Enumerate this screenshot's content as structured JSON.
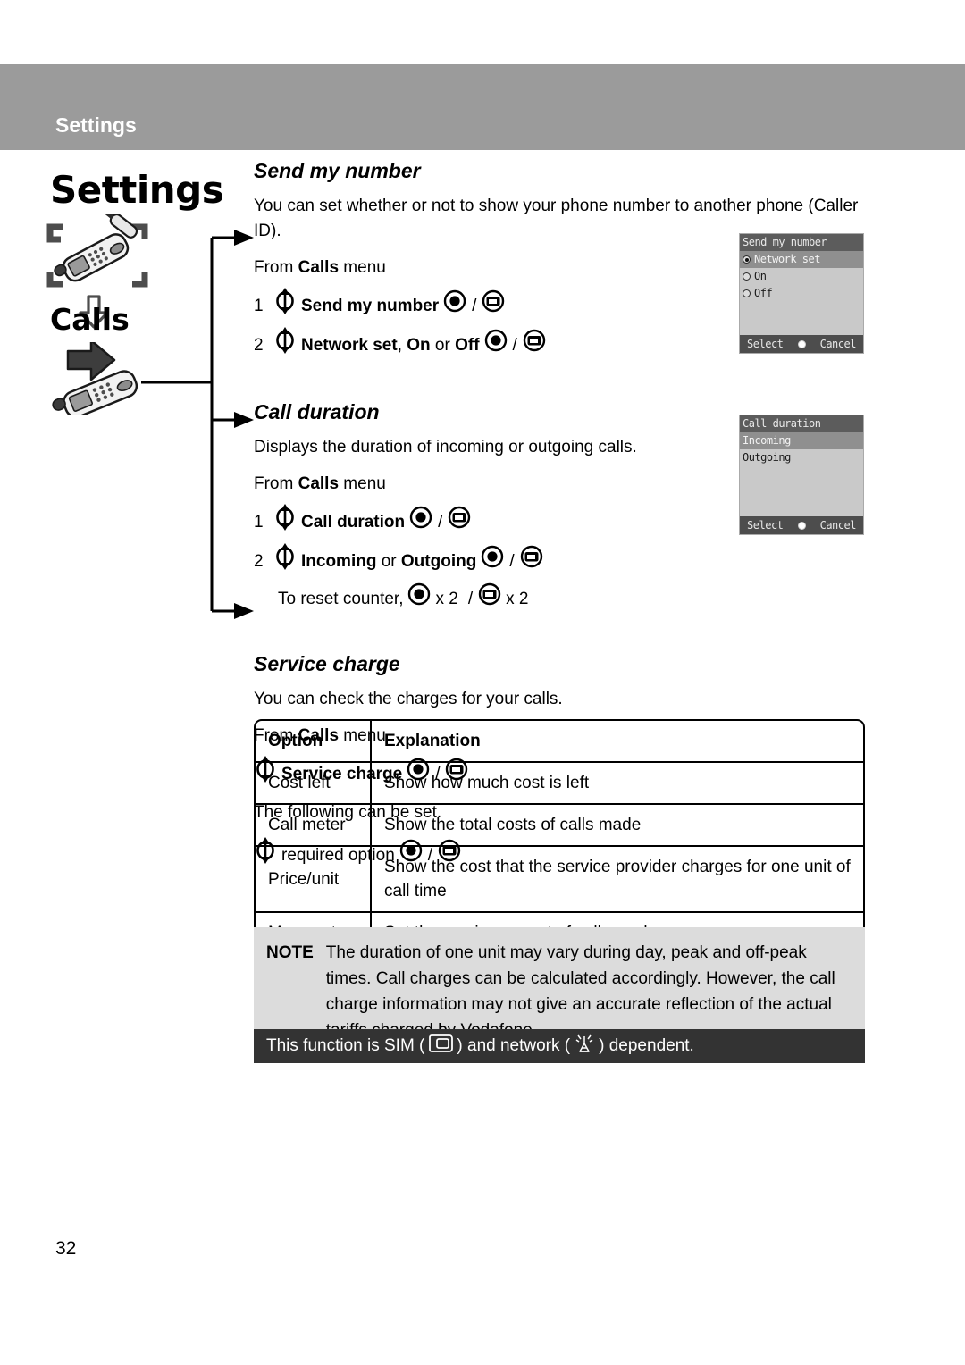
{
  "header": {
    "running_title": "Settings"
  },
  "sidebar": {
    "chapter": "Settings",
    "section": "Calls",
    "icons": {
      "settings": "phone-screwdriver-icon",
      "down": "down-arrow-icon",
      "calls": "phone-arrow-icon"
    }
  },
  "page_number": "32",
  "sections": [
    {
      "title": "Send my number",
      "intro": "You can set whether or not to show your phone number to another phone (Caller ID).",
      "from_prefix": "From ",
      "from_menu": "Calls",
      "from_suffix": " menu",
      "steps": [
        {
          "num": "1",
          "label": "Send my number",
          "label_bold": true
        },
        {
          "num": "2",
          "label_parts": [
            {
              "t": "Network set",
              "b": true
            },
            {
              "t": ", ",
              "b": false
            },
            {
              "t": "On",
              "b": true
            },
            {
              "t": " or ",
              "b": false
            },
            {
              "t": "Off",
              "b": true
            }
          ]
        }
      ]
    },
    {
      "title": "Call duration",
      "intro": "Displays the duration of incoming or outgoing calls.",
      "from_prefix": "From ",
      "from_menu": "Calls",
      "from_suffix": " menu",
      "steps": [
        {
          "num": "1",
          "label": "Call duration",
          "label_bold": true
        },
        {
          "num": "2",
          "label_parts": [
            {
              "t": "Incoming",
              "b": true
            },
            {
              "t": " or ",
              "b": false
            },
            {
              "t": "Outgoing",
              "b": true
            }
          ]
        }
      ],
      "reset_text": "To reset counter,",
      "reset_mult": "x 2"
    },
    {
      "title": "Service charge",
      "intro": "You can check the charges for your calls.",
      "from_prefix": "From ",
      "from_menu": "Calls",
      "from_suffix": " menu",
      "step_label": "Service charge",
      "following_text": "The following can be set.",
      "option_step_label": "required option"
    }
  ],
  "separator": "/",
  "screenshots": [
    {
      "name": "send-my-number-screen",
      "title": "Send my number",
      "rows": [
        {
          "label": "Network set",
          "radio": true,
          "checked": true,
          "selected": true
        },
        {
          "label": "On",
          "radio": true,
          "checked": false,
          "selected": false
        },
        {
          "label": "Off",
          "radio": true,
          "checked": false,
          "selected": false
        }
      ],
      "soft_left": "Select",
      "soft_right": "Cancel"
    },
    {
      "name": "call-duration-screen",
      "title": "Call duration",
      "rows": [
        {
          "label": "Incoming",
          "radio": false,
          "checked": false,
          "selected": true
        },
        {
          "label": "Outgoing",
          "radio": false,
          "checked": false,
          "selected": false
        }
      ],
      "soft_left": "Select",
      "soft_right": "Cancel"
    }
  ],
  "table": {
    "headers": [
      "Option",
      "Explanation"
    ],
    "rows": [
      [
        "Cost left",
        "Show how much cost is left"
      ],
      [
        "Call meter",
        "Show the total costs of calls made"
      ],
      [
        "Price/unit",
        "Show the cost that the service provider charges for one unit of call time"
      ],
      [
        "Max cost",
        "Set the maximum cost of calls made"
      ]
    ]
  },
  "note": {
    "label": "NOTE",
    "text": "The duration of one unit may vary during day, peak and off-peak times. Call charges can be calculated accordingly. However, the call charge information may not give an accurate reflection of the actual tariffs charged by Vodafone."
  },
  "dependency": {
    "part1": "This function is SIM (",
    "part2": ") and network (",
    "part3": ") dependent.",
    "sim_icon": "sim-card-icon",
    "network_icon": "antenna-icon"
  },
  "colors": {
    "header_band": "#9b9b9b",
    "note_bg": "#dcdcdc",
    "dep_bar_bg": "#333333",
    "screen_bg": "#c9c9c9",
    "screen_title_bg": "#5c5c5c",
    "screen_select_bg": "#8f8f8f"
  }
}
